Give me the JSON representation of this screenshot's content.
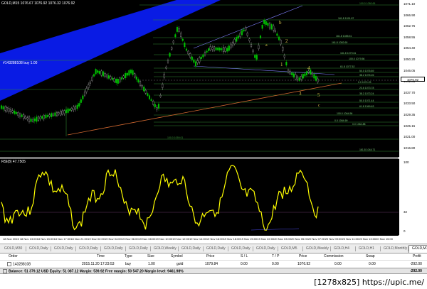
{
  "chart": {
    "title": "GOLD,M15  1076.67  1076.92  1076.32  1076.92",
    "position_label": "#143288108 buy 1.00",
    "current_price": "1076.92",
    "price_labels": [
      "1071.10",
      "1066.90",
      "1062.75",
      "1058.55",
      "1054.40",
      "1050.20",
      "1046.05",
      "1041.85",
      "1037.70",
      "1033.50",
      "1029.35",
      "1025.15",
      "1021.00",
      "1016.80"
    ],
    "fib_levels": [
      {
        "id": "f1",
        "label": "100.0  1080.65"
      },
      {
        "id": "f2",
        "label": "161.8  1091.87"
      },
      {
        "id": "f3",
        "label": "161.8  1085.51"
      },
      {
        "id": "f4",
        "label": "161.8  1082.60"
      },
      {
        "id": "f5",
        "label": "161.8  1079.61"
      },
      {
        "id": "f6",
        "label": "100.0  1079.56"
      },
      {
        "id": "f7",
        "label": "61.8  1077.52"
      },
      {
        "id": "f8",
        "label": "50.0  1076.89"
      },
      {
        "id": "f9",
        "label": "38.2  1076.26"
      },
      {
        "id": "f10",
        "label": "0.0  1074.23"
      },
      {
        "id": "f11",
        "label": "23.6  1073.78"
      },
      {
        "id": "f12",
        "label": "38.2  1073.24"
      },
      {
        "id": "f13",
        "label": "50.0  1071.44"
      },
      {
        "id": "f14",
        "label": "61.8  1069.63"
      },
      {
        "id": "f15",
        "label": "100.0  1064.56"
      },
      {
        "id": "f16",
        "label": "0.0  1064.69"
      },
      {
        "id": "f17",
        "label": "0.0  1064.88"
      },
      {
        "id": "f18",
        "label": "100.0  1059.01"
      },
      {
        "id": "f19",
        "label": "161.8  1044.71"
      }
    ],
    "wave_labels": {
      "b": "b",
      "two": "2",
      "a": "a",
      "one": "1",
      "four": "4",
      "three": "3",
      "five": "5",
      "c": "c"
    },
    "colors": {
      "bull": "#00c000",
      "bear": "#c8c8c8",
      "channel": "#0a1cf0",
      "trend": "#d06830",
      "fib": "#3aa03a",
      "rsi": "#ffff00",
      "wave": "#d4c04a"
    }
  },
  "rsi": {
    "title": "RSI(8) 47.7505",
    "axis_labels": [
      "100",
      "32",
      "0"
    ]
  },
  "time_axis": [
    "18 Nov 2015",
    "18 Nov 13:00",
    "18 Nov 15:00",
    "18 Nov 17:00",
    "18 Nov 21:00",
    "19 Nov 02:00",
    "19 Nov 04:00",
    "19 Nov 06:00",
    "19 Nov 08:00",
    "19 Nov 10:00",
    "19 Nov 12:00",
    "19 Nov 14:00",
    "19 Nov 16:00",
    "19 Nov 18:00",
    "19 Nov 20:00",
    "19 Nov 22:00",
    "20 Nov 03:00",
    "20 Nov 05:00",
    "20 Nov 07:00",
    "20 Nov 09:00",
    "20 Nov 11:00",
    "20 Nov 13:00",
    "20 Nov 15:00"
  ],
  "tabs": [
    "GOLD,M30",
    "GOLD,Daily",
    "GOLD,Daily",
    "GOLD,Daily",
    "GOLD,Daily",
    "GOLD,Daily",
    "GOLD,Weekly",
    "GOLD,Daily",
    "GOLD,Daily",
    "GOLD,Daily",
    "GOLD,Daily",
    "GOLD,M5",
    "GOLD,Weekly",
    "GOLD,H4",
    "GOLD,H1",
    "GOLD,Monthly",
    "GOLD,M15"
  ],
  "selected_tab": 16,
  "terminal": {
    "headers": {
      "order": "Order",
      "time": "Time",
      "type": "Type",
      "size": "Size",
      "symbol": "Symbol",
      "price": "Price",
      "sl": "S / L",
      "tp": "T / P",
      "price2": "Price",
      "commission": "Commission",
      "swap": "Swap",
      "profit": "Profit"
    },
    "row": {
      "order": "143288108",
      "time": "2015.11.20 17:23:53",
      "type": "buy",
      "size": "1.00",
      "symbol": "gold",
      "price": "1079.84",
      "sl": "0.00",
      "tp": "0.00",
      "price2": "1076.92",
      "commission": "0.00",
      "swap": "0.00",
      "profit": "-292.00"
    },
    "balance": "Balance: 51 379.12 USD  Equity: 51 087.12  Margin: 539.92  Free margin: 50 547.20  Margin level: 9461.98%",
    "balance_profit": "-292.00"
  },
  "watermark": "[1278x825] https://upic.me/"
}
